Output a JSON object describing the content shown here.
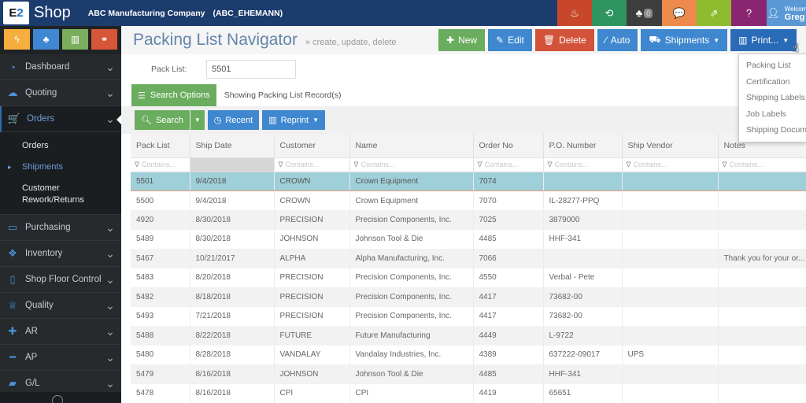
{
  "topbar": {
    "brand": "Shop",
    "logo_text": "E2",
    "company": "ABC Manufacturing Company",
    "company_code": "(ABC_EHEMANN)",
    "icons": [
      {
        "name": "fire-extinguisher-icon",
        "glyph": "♨",
        "color": "#c8472b"
      },
      {
        "name": "refresh-icon",
        "glyph": "⟲",
        "color": "#2f9560"
      },
      {
        "name": "org-chart-icon",
        "glyph": "♣",
        "color": "#3d3d3d",
        "badge": "0"
      },
      {
        "name": "chat-icon",
        "glyph": "💬",
        "color": "#ee8a4b"
      },
      {
        "name": "external-link-icon",
        "glyph": "⇗",
        "color": "#8dbb2e"
      },
      {
        "name": "help-icon",
        "glyph": "?",
        "color": "#8a2570"
      }
    ],
    "welcome_label": "Welcome",
    "user_name": "Greg",
    "welcome_color": "#5a98d6"
  },
  "sidebar": {
    "quick_buttons": [
      {
        "name": "lightning-icon",
        "glyph": "ϟ",
        "color": "#f6ae3e"
      },
      {
        "name": "hierarchy-icon",
        "glyph": "♣",
        "color": "#3e88d3"
      },
      {
        "name": "chart-icon",
        "glyph": "▥",
        "color": "#79ae5c"
      },
      {
        "name": "share-icon",
        "glyph": "⚭",
        "color": "#d75637"
      }
    ],
    "items": [
      {
        "label": "Dashboard",
        "icon": "dashboard-icon",
        "glyph": "◔"
      },
      {
        "label": "Quoting",
        "icon": "chat-bubbles-icon",
        "glyph": "☁"
      },
      {
        "label": "Orders",
        "icon": "cart-icon",
        "glyph": "🛒",
        "active": true,
        "children": [
          {
            "label": "Orders"
          },
          {
            "label": "Shipments",
            "current": true
          },
          {
            "label": "Customer Rework/Returns"
          }
        ]
      },
      {
        "label": "Purchasing",
        "icon": "credit-card-icon",
        "glyph": "▭"
      },
      {
        "label": "Inventory",
        "icon": "cubes-icon",
        "glyph": "❖"
      },
      {
        "label": "Shop Floor Control",
        "icon": "tablet-icon",
        "glyph": "▯"
      },
      {
        "label": "Quality",
        "icon": "trophy-icon",
        "glyph": "♕"
      },
      {
        "label": "AR",
        "icon": "plus-icon",
        "glyph": "✚"
      },
      {
        "label": "AP",
        "icon": "minus-icon",
        "glyph": "━"
      },
      {
        "label": "G/L",
        "icon": "book-icon",
        "glyph": "▰"
      }
    ]
  },
  "header": {
    "title": "Packing List Navigator",
    "subtitle": "» create, update, delete",
    "actions": [
      {
        "label": "New",
        "icon": "plus-icon",
        "glyph": "✚",
        "style": "green"
      },
      {
        "label": "Edit",
        "icon": "pencil-icon",
        "glyph": "✎",
        "style": "blue"
      },
      {
        "label": "Delete",
        "icon": "trash-icon",
        "glyph": "🗑",
        "style": "red"
      },
      {
        "label": "Auto",
        "icon": "magic-wand-icon",
        "glyph": "⁄",
        "style": "blue"
      },
      {
        "label": "Shipments",
        "icon": "truck-icon",
        "glyph": "⛟",
        "style": "blue",
        "caret": true
      },
      {
        "label": "Print...",
        "icon": "bar-chart-icon",
        "glyph": "▥",
        "style": "dblue",
        "caret": true
      }
    ]
  },
  "filters": {
    "pack_list_label": "Pack List:",
    "pack_list_value": "5501",
    "search_options_label": "Search Options",
    "showing_text": "Showing Packing List Record(s)"
  },
  "toolbar": {
    "search_label": "Search",
    "recent_label": "Recent",
    "reprint_label": "Reprint"
  },
  "grid": {
    "columns": [
      "Pack List",
      "Ship Date",
      "Customer",
      "Name",
      "Order No",
      "P.O. Number",
      "Ship Vendor",
      "Notes"
    ],
    "filter_placeholder": "Contains...",
    "rows": [
      [
        "5501",
        "9/4/2018",
        "CROWN",
        "Crown Equipment",
        "7074",
        "",
        "",
        ""
      ],
      [
        "5500",
        "9/4/2018",
        "CROWN",
        "Crown Equipment",
        "7070",
        "IL-28277-PPQ",
        "",
        ""
      ],
      [
        "4920",
        "8/30/2018",
        "PRECISION",
        "Precision Components, Inc.",
        "7025",
        "3879000",
        "",
        ""
      ],
      [
        "5489",
        "8/30/2018",
        "JOHNSON",
        "Johnson Tool & Die",
        "4485",
        "HHF-341",
        "",
        ""
      ],
      [
        "5467",
        "10/21/2017",
        "ALPHA",
        "Alpha Manufacturing, Inc.",
        "7066",
        "",
        "",
        "Thank you for your or..."
      ],
      [
        "5483",
        "8/20/2018",
        "PRECISION",
        "Precision Components, Inc.",
        "4550",
        "Verbal - Pete",
        "",
        ""
      ],
      [
        "5482",
        "8/18/2018",
        "PRECISION",
        "Precision Components, Inc.",
        "4417",
        "73682-00",
        "",
        ""
      ],
      [
        "5493",
        "7/21/2018",
        "PRECISION",
        "Precision Components, Inc.",
        "4417",
        "73682-00",
        "",
        ""
      ],
      [
        "5488",
        "8/22/2018",
        "FUTURE",
        "Future Manufacturing",
        "4449",
        "L-9722",
        "",
        ""
      ],
      [
        "5480",
        "8/28/2018",
        "VANDALAY",
        "Vandalay Industries, Inc.",
        "4389",
        "637222-09017",
        "UPS",
        ""
      ],
      [
        "5479",
        "8/16/2018",
        "JOHNSON",
        "Johnson Tool & Die",
        "4485",
        "HHF-341",
        "",
        ""
      ],
      [
        "5478",
        "8/16/2018",
        "CPI",
        "CPI",
        "4419",
        "65651",
        "",
        ""
      ]
    ],
    "selected_row": 0
  },
  "print_menu": {
    "items": [
      "Packing List",
      "Certification",
      "Shipping Labels",
      "Job Labels",
      "Shipping Documents"
    ]
  }
}
